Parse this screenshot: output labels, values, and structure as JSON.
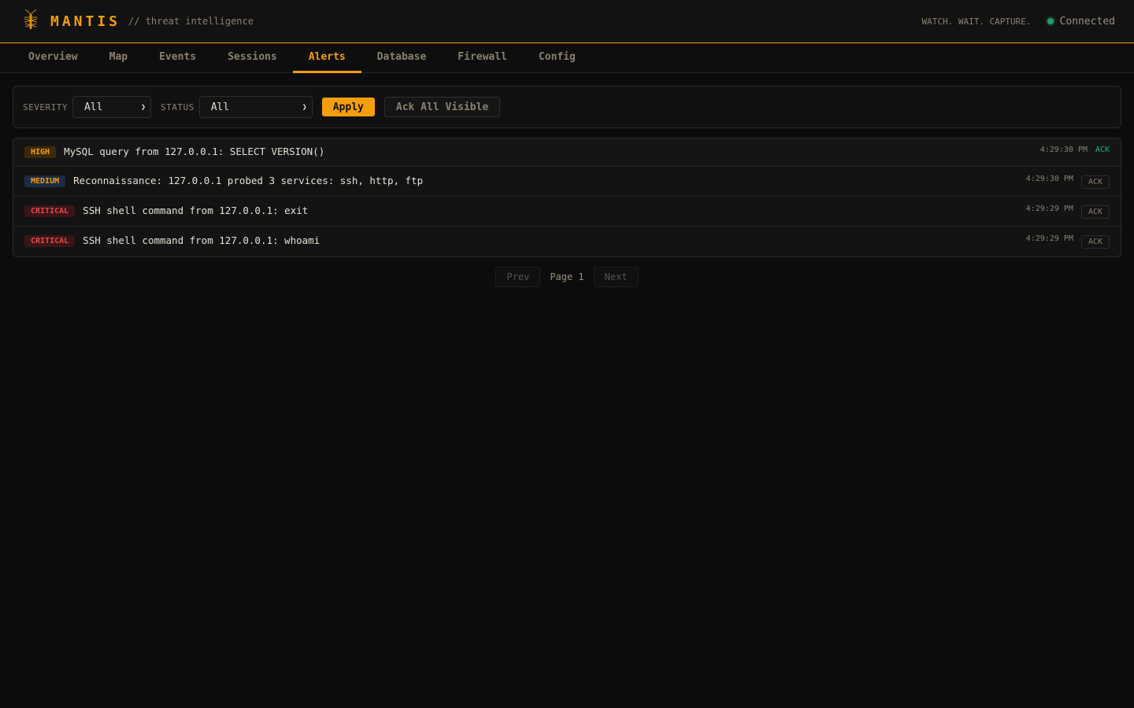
{
  "header": {
    "brand": "MANTIS",
    "tagline": "// threat intelligence",
    "motto": "WATCH. WAIT. CAPTURE.",
    "status": "Connected"
  },
  "nav": {
    "tabs": [
      "Overview",
      "Map",
      "Events",
      "Sessions",
      "Alerts",
      "Database",
      "Firewall",
      "Config"
    ],
    "active": "Alerts"
  },
  "filters": {
    "severity_label": "SEVERITY",
    "severity_value": "All",
    "status_label": "STATUS",
    "status_value": "All",
    "apply_label": "Apply",
    "ack_all_label": "Ack All Visible"
  },
  "alerts": [
    {
      "severity": "HIGH",
      "message": "MySQL query from 127.0.0.1: SELECT VERSION()",
      "time": "4:29:30 PM",
      "ack": "ACK",
      "acknowledged": true
    },
    {
      "severity": "MEDIUM",
      "message": "Reconnaissance: 127.0.0.1 probed 3 services: ssh, http, ftp",
      "time": "4:29:30 PM",
      "ack": "ACK",
      "acknowledged": false
    },
    {
      "severity": "CRITICAL",
      "message": "SSH shell command from 127.0.0.1: exit",
      "time": "4:29:29 PM",
      "ack": "ACK",
      "acknowledged": false
    },
    {
      "severity": "CRITICAL",
      "message": "SSH shell command from 127.0.0.1: whoami",
      "time": "4:29:29 PM",
      "ack": "ACK",
      "acknowledged": false
    }
  ],
  "pagination": {
    "prev": "Prev",
    "page": "Page 1",
    "next": "Next"
  },
  "colors": {
    "accent": "#f59e0b",
    "connected": "#1f9d6b",
    "acked": "#10b981",
    "critical": "#e5484d"
  }
}
